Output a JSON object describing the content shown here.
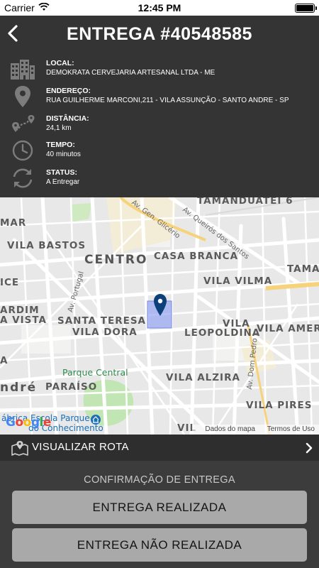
{
  "status_bar": {
    "carrier": "Carrier",
    "time": "12:45 PM"
  },
  "header": {
    "title": "ENTREGA #40548585",
    "fields": [
      {
        "label": "LOCAL:",
        "value": "DEMOKRATA CERVEJARIA ARTESANAL LTDA - ME",
        "icon": "building-icon"
      },
      {
        "label": "ENDEREÇO:",
        "value": "RUA GUILHERME MARCONI,211 - VILA ASSUNÇÃO - SANTO ANDRE - SP",
        "icon": "location-pin-icon"
      },
      {
        "label": "DISTÂNCIA:",
        "value": "24,1 km",
        "icon": "route-icon"
      },
      {
        "label": "TEMPO:",
        "value": "40 minutos",
        "icon": "clock-icon"
      },
      {
        "label": "STATUS:",
        "value": "A Entregar",
        "icon": "refresh-icon"
      }
    ]
  },
  "map": {
    "labels": {
      "tamanduatei": "TAMANDUATEÍ 6",
      "queiroz": "Av. Queirós dos Santos",
      "glicerio": "Av. Gen. Glicério",
      "mar": "MAR",
      "vila_bastos": "VILA BASTOS",
      "centro": "CENTRO",
      "casa_branca": "CASA BRANCA",
      "tama": "TAMA",
      "ice": "ICE",
      "portugal": "Av. Portugal",
      "vila_vilma": "VILA VILMA",
      "ardim": "ARDIM",
      "a_vista": "A VISTA",
      "santa_teresa": "SANTA TERESA",
      "vila": "VILA",
      "vila_dora": "VILA DORA",
      "leopoldina": "LEOPOLDINA",
      "vila_amer": "VILA AMER",
      "dom_pedro": "Av. Dom Pedro I",
      "parque_central": "Parque Central",
      "a": "A",
      "vila_alzira": "VILA ALZIRA",
      "ndre": "ndré",
      "paraiso": "PARAÍSO",
      "vila_pires": "VILA PIRES",
      "fabrica": "ábrica Escola Parque",
      "conhecimento": "do Conhecimento",
      "vil": "VIL",
      "google": "Google",
      "map_data": "Dados do mapa",
      "terms": "Termos de Uso"
    }
  },
  "route": {
    "label": "VISUALIZAR ROTA"
  },
  "confirmation": {
    "title": "CONFIRMAÇÃO DE ENTREGA",
    "delivered_label": "ENTREGA REALIZADA",
    "not_delivered_label": "ENTREGA NÃO REALIZADA"
  },
  "colors": {
    "header_bg": "#343434",
    "button_bg": "#a9a9a9",
    "pin": "#0d3f7a",
    "highlight": "#8fa0f5"
  }
}
